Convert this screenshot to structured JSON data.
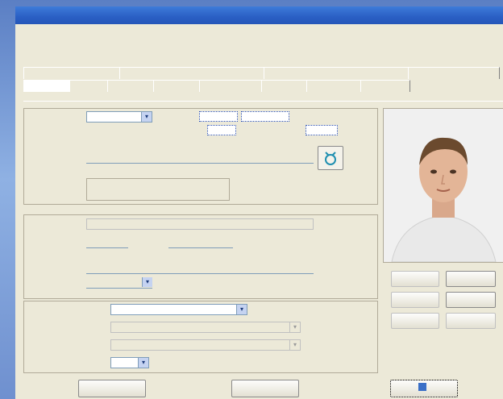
{
  "window": {
    "title": ""
  },
  "header": {
    "line1": "",
    "line2a": "",
    "line2b": "",
    "line2c": "",
    "line2d": "",
    "line3": ""
  },
  "tabs_row1": [
    "",
    "",
    "",
    ""
  ],
  "tabs_row2": [
    "",
    "",
    "",
    "",
    "",
    "",
    "",
    ""
  ],
  "form": {
    "group1_title": "",
    "birth_label": "",
    "photo_label": "",
    "photo_value": "",
    "photo_to": "",
    "issued_label": "",
    "issued_value": "",
    "date_label": "",
    "date_value": "",
    "place_label": "",
    "place_value": "",
    "gender_label": "",
    "gender_options": "",
    "group2_title": "",
    "doc_label": "",
    "doc_value": "",
    "series_label": "",
    "number_label": "",
    "issued_by_label": "",
    "date2_label": "",
    "program_label": "",
    "program_value": "",
    "specialty_label": "",
    "specialty_value": "",
    "form_label": "",
    "form_value": "",
    "course_label": "",
    "course_value": ""
  },
  "photo_buttons": {
    "load": "",
    "print": "",
    "save": "",
    "delete": "",
    "scan": "",
    "camera": ""
  },
  "footer": {
    "ok": "",
    "cancel": "",
    "help": ""
  }
}
